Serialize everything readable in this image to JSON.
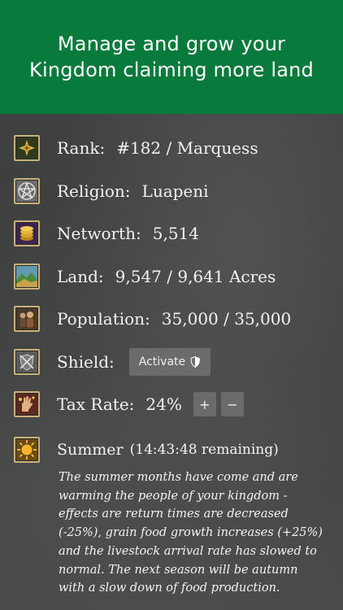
{
  "banner": {
    "line1": "Manage and grow your",
    "line2": "Kingdom claiming more land",
    "color": "#087a3b"
  },
  "stats": {
    "rank": {
      "label": "Rank:",
      "value": "#182 / Marquess",
      "icon": "rank-star-icon"
    },
    "religion": {
      "label": "Religion:",
      "value": "Luapeni",
      "icon": "pentagram-icon"
    },
    "networth": {
      "label": "Networth:",
      "value": "5,514",
      "icon": "gold-coins-icon"
    },
    "land": {
      "label": "Land:",
      "value": "9,547 / 9,641 Acres",
      "icon": "landscape-icon"
    },
    "population": {
      "label": "Population:",
      "value": "35,000 / 35,000",
      "icon": "people-icon"
    },
    "shield": {
      "label": "Shield:",
      "button": "Activate",
      "icon": "crossed-swords-shield-icon"
    },
    "tax": {
      "label": "Tax Rate:",
      "value": "24%",
      "increase": "+",
      "decrease": "−",
      "icon": "hand-coins-icon"
    }
  },
  "season": {
    "name": "Summer",
    "remaining": "(14:43:48 remaining)",
    "icon": "sun-icon",
    "description": "The summer months have come and are warming the people of your kingdom - effects are return times are decreased (-25%), grain food growth increases (+25%) and the livestock arrival rate has slowed to normal. The next season will be autumn with a slow down of food production."
  }
}
